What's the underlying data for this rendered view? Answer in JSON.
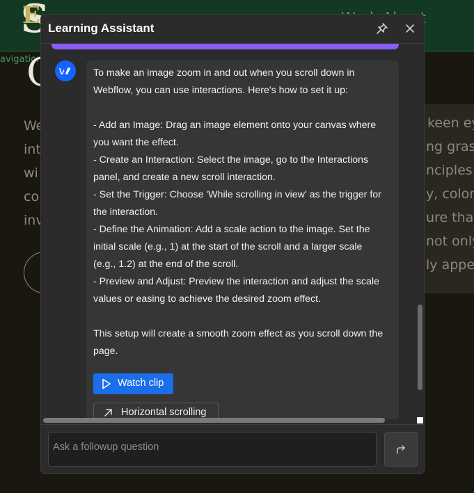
{
  "background": {
    "logo_mark": "E",
    "logo_text": "S",
    "nav_link": "Work About",
    "navigation_label": "avigation",
    "hero_letter": "C",
    "left_lines": [
      "We",
      "inte",
      "wi",
      "co",
      "inv"
    ],
    "right_lines": [
      "keen ey",
      "ng grasp",
      "nciples. V",
      "y, color t",
      "ure that",
      "not only",
      "ly appea"
    ]
  },
  "window": {
    "title": "Learning Assistant"
  },
  "message": {
    "paragraphs": [
      "To make an image zoom in and out when you scroll down in Webflow, you can use interactions. Here's how to set it up:",
      "",
      "- Add an Image: Drag an image element onto your canvas where you want the effect.",
      "- Create an Interaction: Select the image, go to the Interactions panel, and create a new scroll interaction.",
      "- Set the Trigger: Choose 'While scrolling in view' as the trigger for the interaction.",
      "- Define the Animation: Add a scale action to the image. Set the initial scale (e.g., 1) at the start of the scroll and a larger scale (e.g., 1.2) at the end of the scroll.",
      "- Preview and Adjust: Preview the interaction and adjust the scale values or easing to achieve the desired zoom effect.",
      "",
      "This setup will create a smooth zoom effect as you scroll down the page."
    ],
    "watch_clip_label": "Watch clip",
    "related_link_label": "Horizontal scrolling"
  },
  "composer": {
    "placeholder": "Ask a followup question"
  },
  "colors": {
    "accent_purple": "#8b5cf6",
    "button_blue": "#1a6ee8",
    "avatar_blue": "#1463ff",
    "window_bg": "#2b2b2b",
    "bubble_bg": "#363636"
  },
  "icons": {
    "avatar": "webflow-logo-icon",
    "pin": "pin-icon",
    "close": "close-icon",
    "play": "play-icon",
    "link": "arrow-up-right-icon",
    "send": "reply-arrow-icon"
  }
}
